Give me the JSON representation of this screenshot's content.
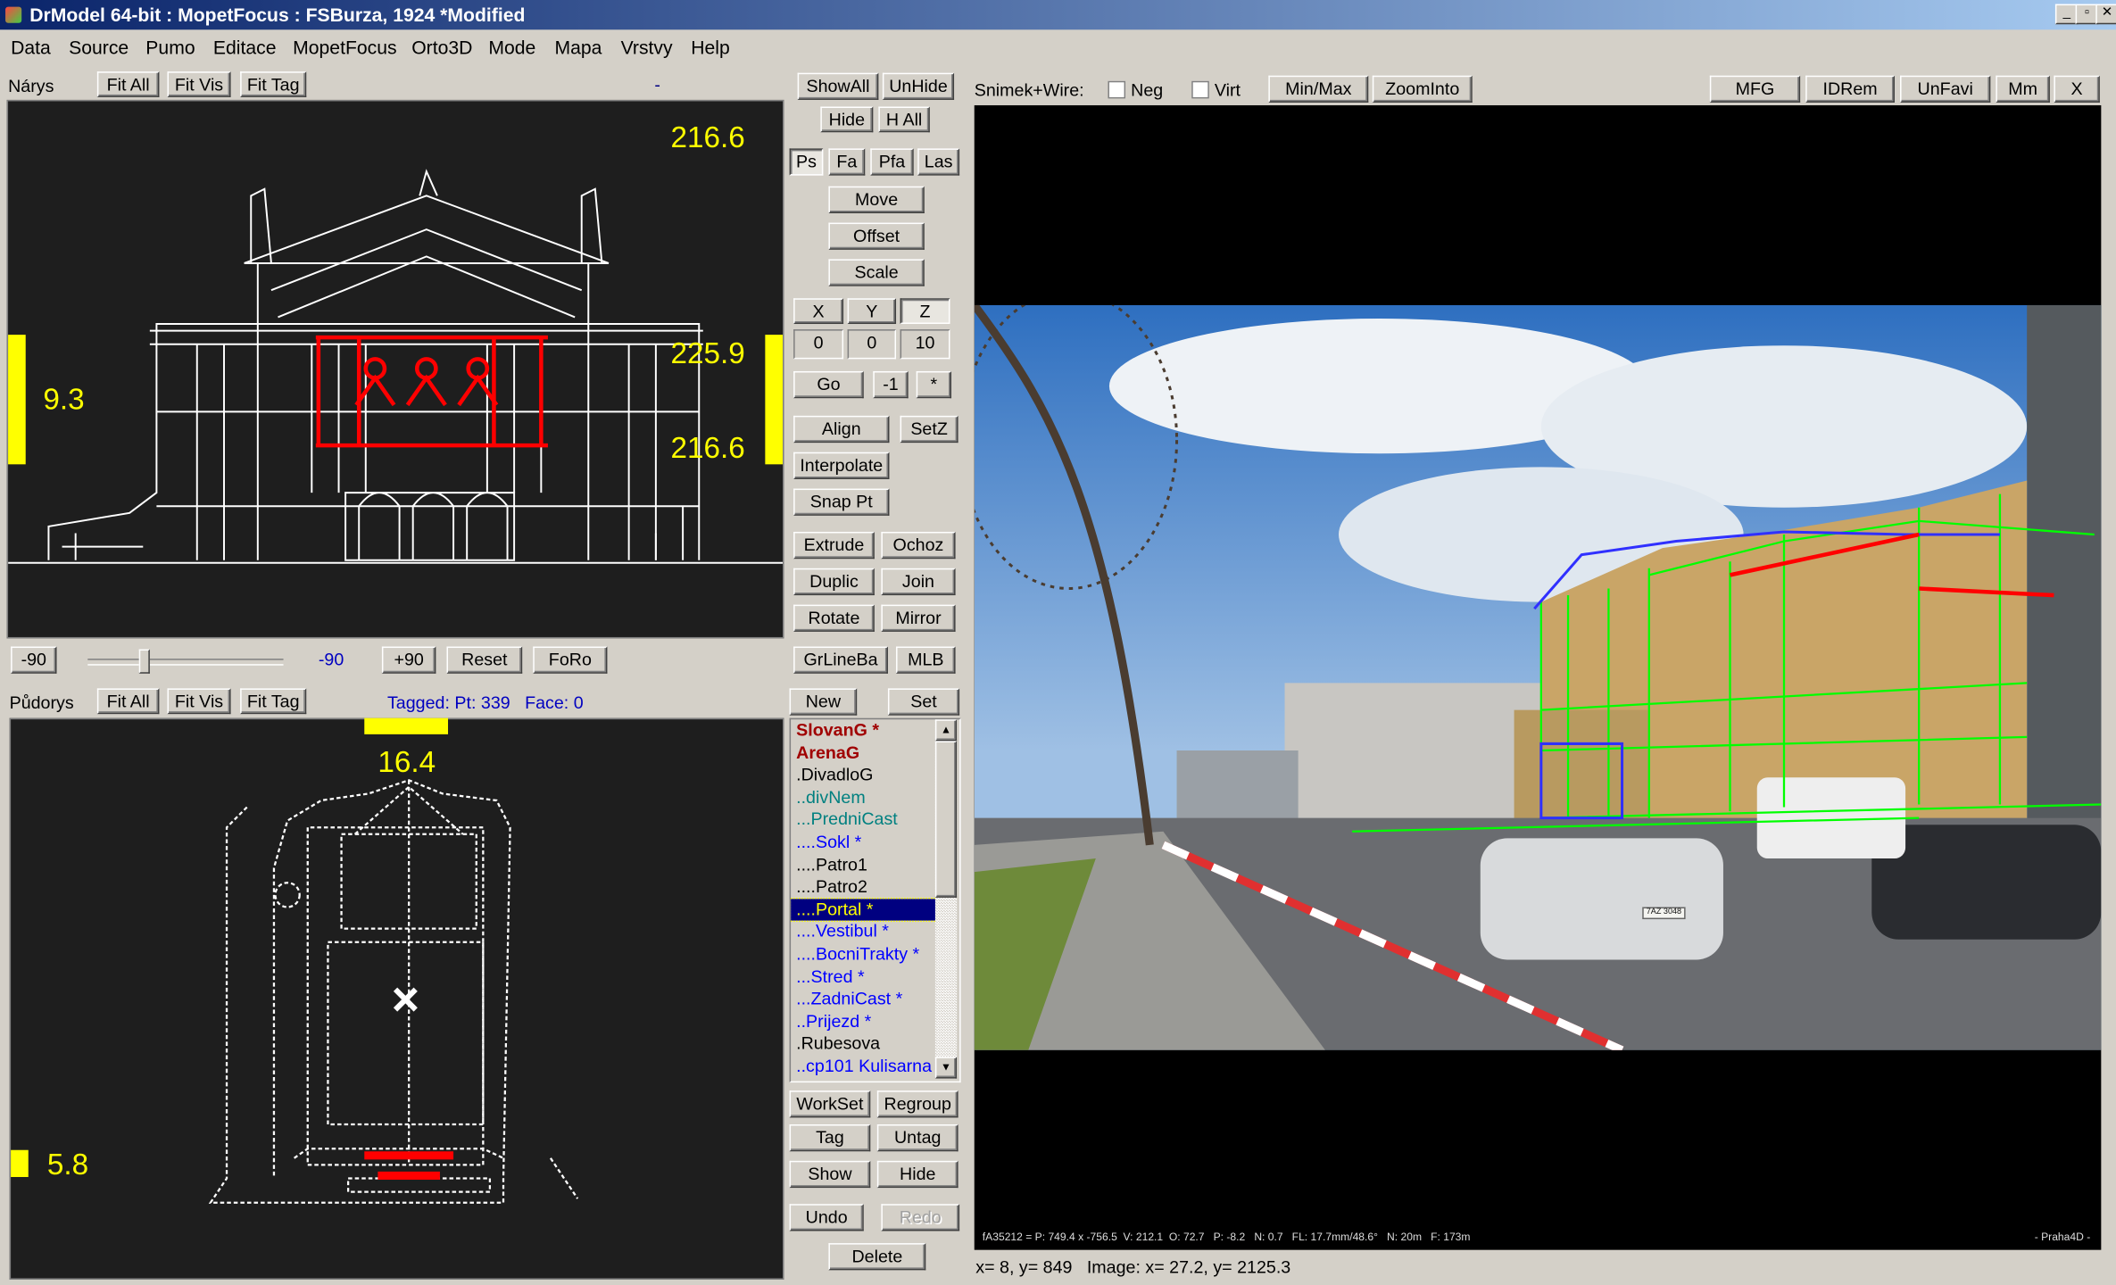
{
  "window": {
    "title": "DrModel 64-bit : MopetFocus : FSBurza, 1924 *Modified",
    "min": "_",
    "max": "▫",
    "close": "✕"
  },
  "menu": [
    "Data",
    "Source",
    "Pumo",
    "Editace",
    "MopetFocus",
    "Orto3D",
    "Mode",
    "Mapa",
    "Vrstvy",
    "Help"
  ],
  "narys": {
    "label": "Nárys",
    "fit_all": "Fit All",
    "fit_vis": "Fit Vis",
    "fit_tag": "Fit Tag",
    "dash": "-",
    "top_value": "216.6",
    "left_value": "9.3",
    "right_top": "225.9",
    "right_bottom": "216.6"
  },
  "rotation": {
    "minus": "-90",
    "value": "-90",
    "plus": "+90",
    "reset": "Reset",
    "foro": "FoRo",
    "slider_value": -90
  },
  "pudorys": {
    "label": "Půdorys",
    "fit_all": "Fit All",
    "fit_vis": "Fit Vis",
    "fit_tag": "Fit Tag",
    "tagged": "Tagged: Pt: 339   Face: 0",
    "top_value": "16.4",
    "left_value": "5.8"
  },
  "tools": {
    "show_all": "ShowAll",
    "unhide": "UnHide",
    "hide": "Hide",
    "h_all": "H All",
    "modes": [
      "Ps",
      "Fa",
      "Pfa",
      "Las"
    ],
    "active_mode": "Ps",
    "move": "Move",
    "offset": "Offset",
    "scale": "Scale",
    "axes": [
      "X",
      "Y",
      "Z"
    ],
    "active_axis": "Z",
    "axis_values": [
      "0",
      "0",
      "10"
    ],
    "go": "Go",
    "minus1": "-1",
    "star": "*",
    "align": "Align",
    "setz": "SetZ",
    "interpolate": "Interpolate",
    "snap": "Snap Pt",
    "extrude": "Extrude",
    "ochoz": "Ochoz",
    "duplic": "Duplic",
    "join": "Join",
    "rotate": "Rotate",
    "mirror": "Mirror",
    "grlineba": "GrLineBa",
    "mlb": "MLB",
    "new": "New",
    "set": "Set",
    "workset": "WorkSet",
    "regroup": "Regroup",
    "tag": "Tag",
    "untag": "Untag",
    "show": "Show",
    "hide2": "Hide",
    "undo": "Undo",
    "redo": "Redo",
    "delete": "Delete"
  },
  "layers": [
    {
      "label": "SlovanG *",
      "color": "#a00000",
      "bold": true
    },
    {
      "label": "ArenaG",
      "color": "#a00000",
      "bold": true
    },
    {
      "label": ".DivadloG",
      "color": "#000000"
    },
    {
      "label": "..divNem",
      "color": "#008080"
    },
    {
      "label": "...PredniCast",
      "color": "#008080"
    },
    {
      "label": "....Sokl *",
      "color": "#0000ff"
    },
    {
      "label": "....Patro1",
      "color": "#000000"
    },
    {
      "label": "....Patro2",
      "color": "#000000"
    },
    {
      "label": "....Portal *",
      "color": "#ffff00",
      "selected": true
    },
    {
      "label": "....Vestibul *",
      "color": "#0000ff"
    },
    {
      "label": "....BocniTrakty *",
      "color": "#0000ff"
    },
    {
      "label": "...Stred *",
      "color": "#0000ff"
    },
    {
      "label": "...ZadniCast *",
      "color": "#0000ff"
    },
    {
      "label": "..Prijezd *",
      "color": "#0000ff"
    },
    {
      "label": ".Rubesova",
      "color": "#000000"
    },
    {
      "label": "..cp101 Kulisarna *",
      "color": "#0000ff"
    }
  ],
  "photo": {
    "toolbar_label": "Snimek+Wire:",
    "neg": "Neg",
    "virt": "Virt",
    "minmax": "Min/Max",
    "zoominto": "ZoomInto",
    "mfg": "MFG",
    "idrem": "IDRem",
    "unfavi": "UnFavi",
    "mm": "Mm",
    "x": "X",
    "info": "fA35212 = P: 749.4 x -756.5  V: 212.1  O: 72.7   P: -8.2   N: 0.7   FL: 17.7mm/48.6°   N: 20m   F: 173m",
    "credit": "- Praha4D -",
    "plate": "7AZ 3048"
  },
  "status": "x= 8, y= 849   Image: x= 27.2, y= 2125.3",
  "colors": {
    "highlight": "#ffff00",
    "tagged": "#ff0000",
    "wire_green": "#00ff00",
    "wire_blue": "#3030ff"
  }
}
